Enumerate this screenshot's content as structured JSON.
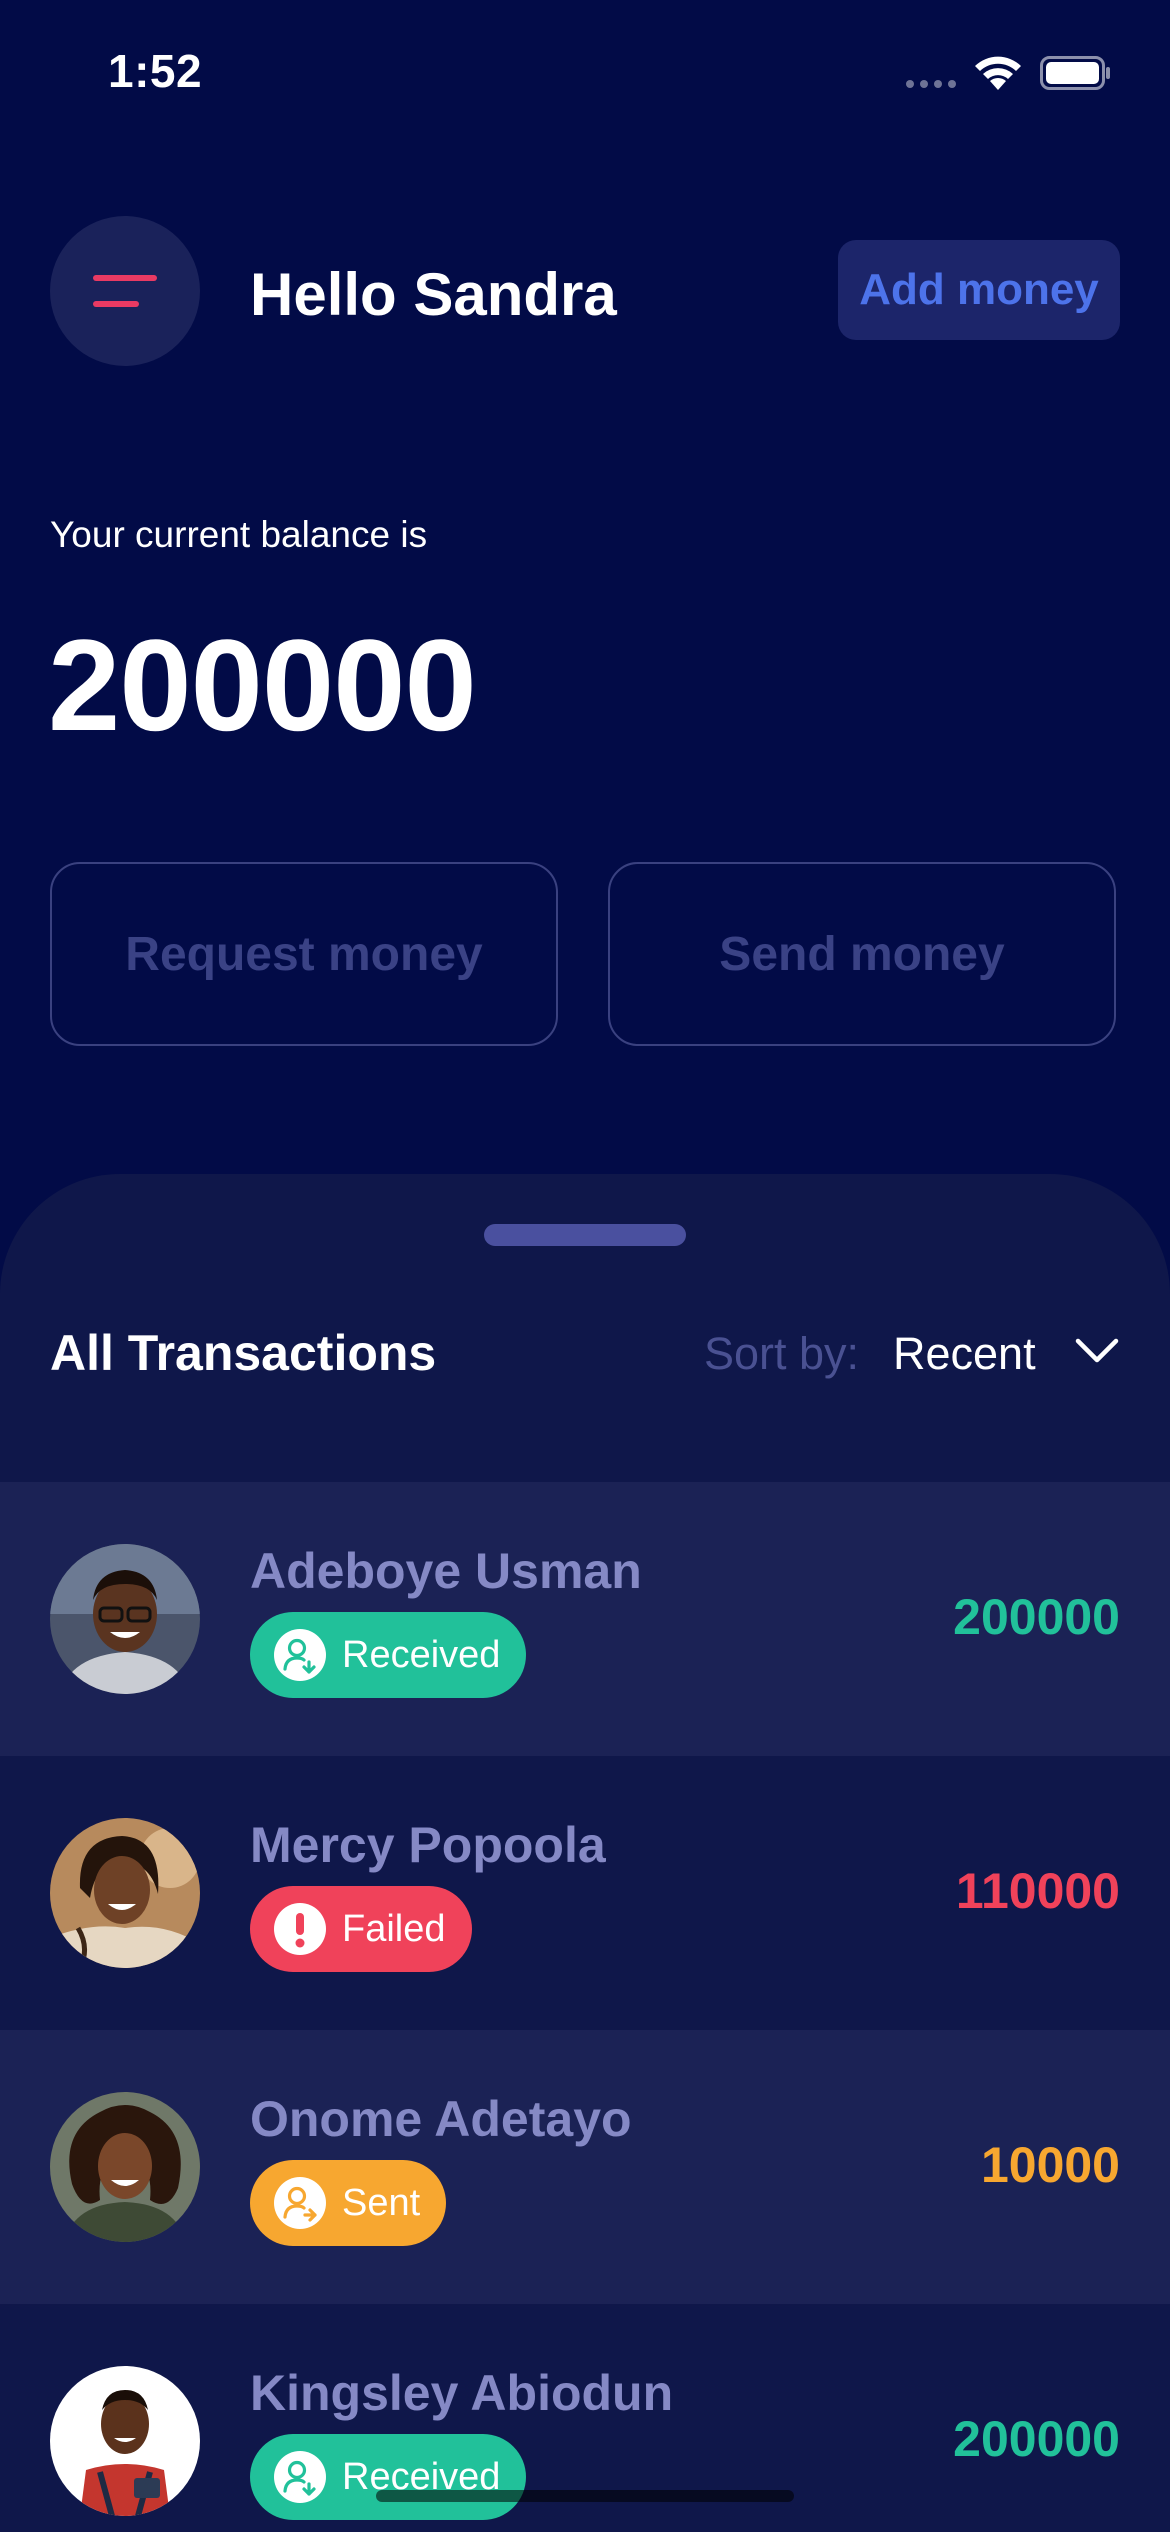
{
  "status_bar": {
    "time": "1:52"
  },
  "header": {
    "greeting": "Hello Sandra",
    "add_money_label": "Add money"
  },
  "balance": {
    "caption": "Your current balance is",
    "value": "200000"
  },
  "actions": {
    "request_label": "Request money",
    "send_label": "Send money"
  },
  "transactions": {
    "title": "All Transactions",
    "sort_label": "Sort by:",
    "sort_value": "Recent",
    "items": [
      {
        "name": "Adeboye Usman",
        "status": "Received",
        "amount": "200000",
        "color": "#21c19a"
      },
      {
        "name": "Mercy Popoola",
        "status": "Failed",
        "amount": "110000",
        "color": "#f0425a"
      },
      {
        "name": "Onome Adetayo",
        "status": "Sent",
        "amount": "10000",
        "color": "#f7a730"
      },
      {
        "name": "Kingsley Abiodun",
        "status": "Received",
        "amount": "200000",
        "color": "#21c19a"
      }
    ]
  },
  "colors": {
    "background": "#020b47",
    "sheet": "#0f174a",
    "accent": "#e93a63",
    "link": "#4d73ea",
    "received": "#21c19a",
    "failed": "#f0425a",
    "sent": "#f7a730"
  },
  "icons": [
    "menu-icon",
    "wifi-icon",
    "battery-icon",
    "chevron-down-icon",
    "user-received-icon",
    "alert-icon",
    "user-sent-icon"
  ]
}
